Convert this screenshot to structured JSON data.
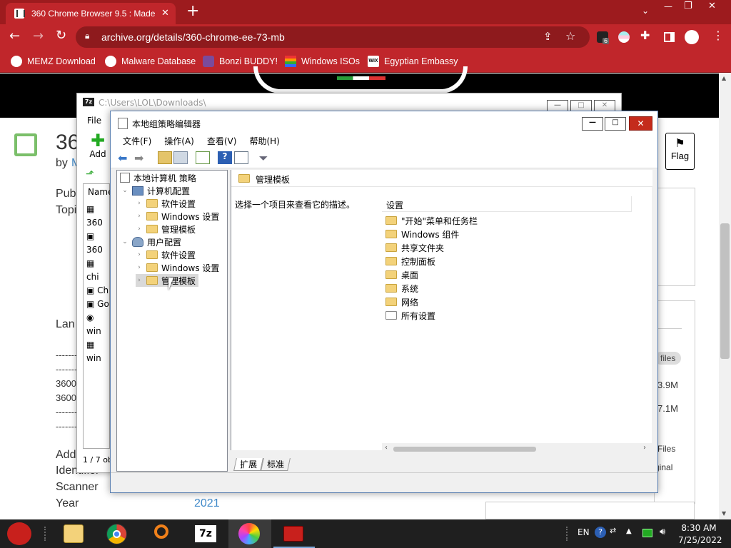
{
  "browser": {
    "tab_title": "360 Chrome Browser 9.5 : Made",
    "tab_close": "✕",
    "new_tab": "+",
    "url": "archive.org/details/360-chrome-ee-73-mb",
    "extension_badge": "6",
    "bookmarks": [
      {
        "label": "MEMZ Download",
        "icon": "globe-icon"
      },
      {
        "label": "Malware Database",
        "icon": "globe-icon"
      },
      {
        "label": "Bonzi BUDDY!",
        "icon": "bonzi-icon"
      },
      {
        "label": "Windows ISOs",
        "icon": "windows-flag-icon"
      },
      {
        "label": "Egyptian Embassy",
        "icon": "wix-icon"
      }
    ],
    "window_controls": {
      "minimize": "—",
      "restore": "❐",
      "close": "✕"
    }
  },
  "archive_page": {
    "title_fragment": "36",
    "by_fragment": "by",
    "by_link": "M",
    "published_label": "Pub",
    "topics_label": "Topi",
    "language_label": "Lan",
    "dashes": [
      "-------",
      "-------",
      "3600",
      "3600",
      "-------",
      "-------"
    ],
    "addeddate_label": "Add",
    "identifier_label": "Identifier",
    "scanner_label": "Scanner",
    "year_label": "Year",
    "year_value": "2021",
    "flag_label": "Flag",
    "files_badge": "files",
    "size1": "3.9M",
    "size2": "7.1M",
    "files_link": "Files",
    "original_link": "ginal"
  },
  "zip_window": {
    "title": "C:\\Users\\LOL\\Downloads\\",
    "menu_file": "File",
    "add_label": "Add",
    "column_name": "Name",
    "rows": [
      "360",
      "360",
      "chi",
      "Ch",
      "Go",
      "win",
      "win"
    ],
    "status": "1 / 7 ob"
  },
  "gpe": {
    "title": "本地组策略编辑器",
    "menu": [
      "文件(F)",
      "操作(A)",
      "查看(V)",
      "帮助(H)"
    ],
    "tree": {
      "root": "本地计算机 策略",
      "computer_config": "计算机配置",
      "user_config": "用户配置",
      "children_computer": [
        "软件设置",
        "Windows 设置",
        "管理模板"
      ],
      "children_user": [
        "软件设置",
        "Windows 设置",
        "管理模板"
      ]
    },
    "right_header": "管理模板",
    "description": "选择一个项目来查看它的描述。",
    "column_settings": "设置",
    "items": [
      "\"开始\"菜单和任务栏",
      "Windows 组件",
      "共享文件夹",
      "控制面板",
      "桌面",
      "系统",
      "网络",
      "所有设置"
    ],
    "tabs": [
      "扩展",
      "标准"
    ]
  },
  "taskbar": {
    "lang": "EN",
    "time": "8:30 AM",
    "date": "7/25/2022",
    "apps": [
      "angry-birds-icon",
      "file-explorer-icon",
      "chrome-icon",
      "search-tool-icon",
      "7zip-icon",
      "photos-icon",
      "toolbox-icon"
    ]
  }
}
